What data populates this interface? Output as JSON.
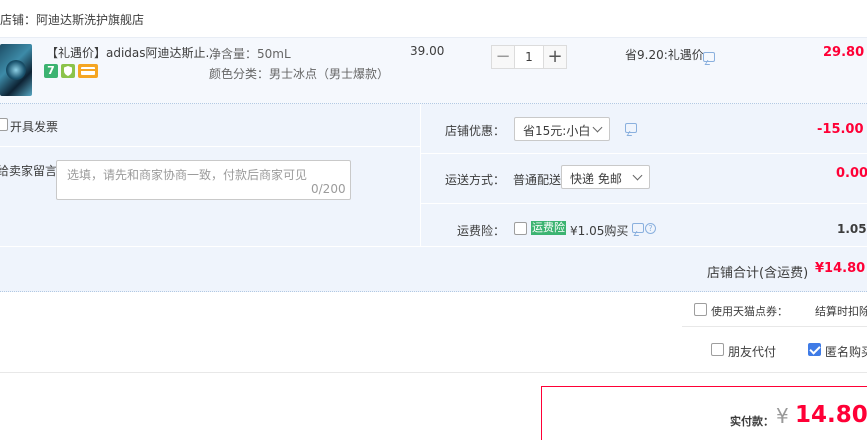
{
  "shop": {
    "label": "店铺：阿迪达斯洗护旗舰店"
  },
  "item": {
    "name": "【礼遇价】adidas阿迪达斯止...",
    "badges": [
      {
        "icon": "seven-day-return-icon",
        "text": "7",
        "color": "#3cb371"
      },
      {
        "icon": "shield-icon",
        "text": "",
        "color": "#8bc34a"
      },
      {
        "icon": "card-icon",
        "text": "",
        "color": "#f5a623"
      }
    ],
    "attr1_label": "净含量：",
    "attr1_value": "50mL",
    "attr2_label": "颜色分类：",
    "attr2_value": "男士冰点（男士爆款）",
    "unit_price": "39.00",
    "qty_minus": "−",
    "qty": "1",
    "qty_plus": "+",
    "discount_text": "省9.20:礼遇价",
    "subtotal": "29.80"
  },
  "invoice": {
    "label": "开具发票"
  },
  "message": {
    "label": "给卖家留言：",
    "placeholder": "选填，请先和商家协商一致，付款后商家可见",
    "count": "0/200"
  },
  "coupon": {
    "label": "店铺优惠：",
    "selected": "省15元:小白",
    "amount": "-15.00"
  },
  "shipping": {
    "label": "运送方式：",
    "method": "普通配送",
    "selected": "快递 免邮",
    "amount": "0.00"
  },
  "insurance": {
    "label": "运费险：",
    "tag": "运费险",
    "price": "¥1.05购买",
    "amount": "1.05"
  },
  "shop_total": {
    "label": "店铺合计(含运费)",
    "amount": "¥14.80"
  },
  "tmall_points": {
    "label": "使用天猫点券：",
    "deduct": "结算时扣除"
  },
  "friend_pay": {
    "label": "朋友代付"
  },
  "anonymous": {
    "label": "匿名购买"
  },
  "pay": {
    "label": "实付款：",
    "currency": "¥",
    "amount": "14.80"
  },
  "colors": {
    "accent_red": "#ff0036",
    "panel_bg": "#eff4fc",
    "checkbox_blue": "#3f7be6"
  }
}
